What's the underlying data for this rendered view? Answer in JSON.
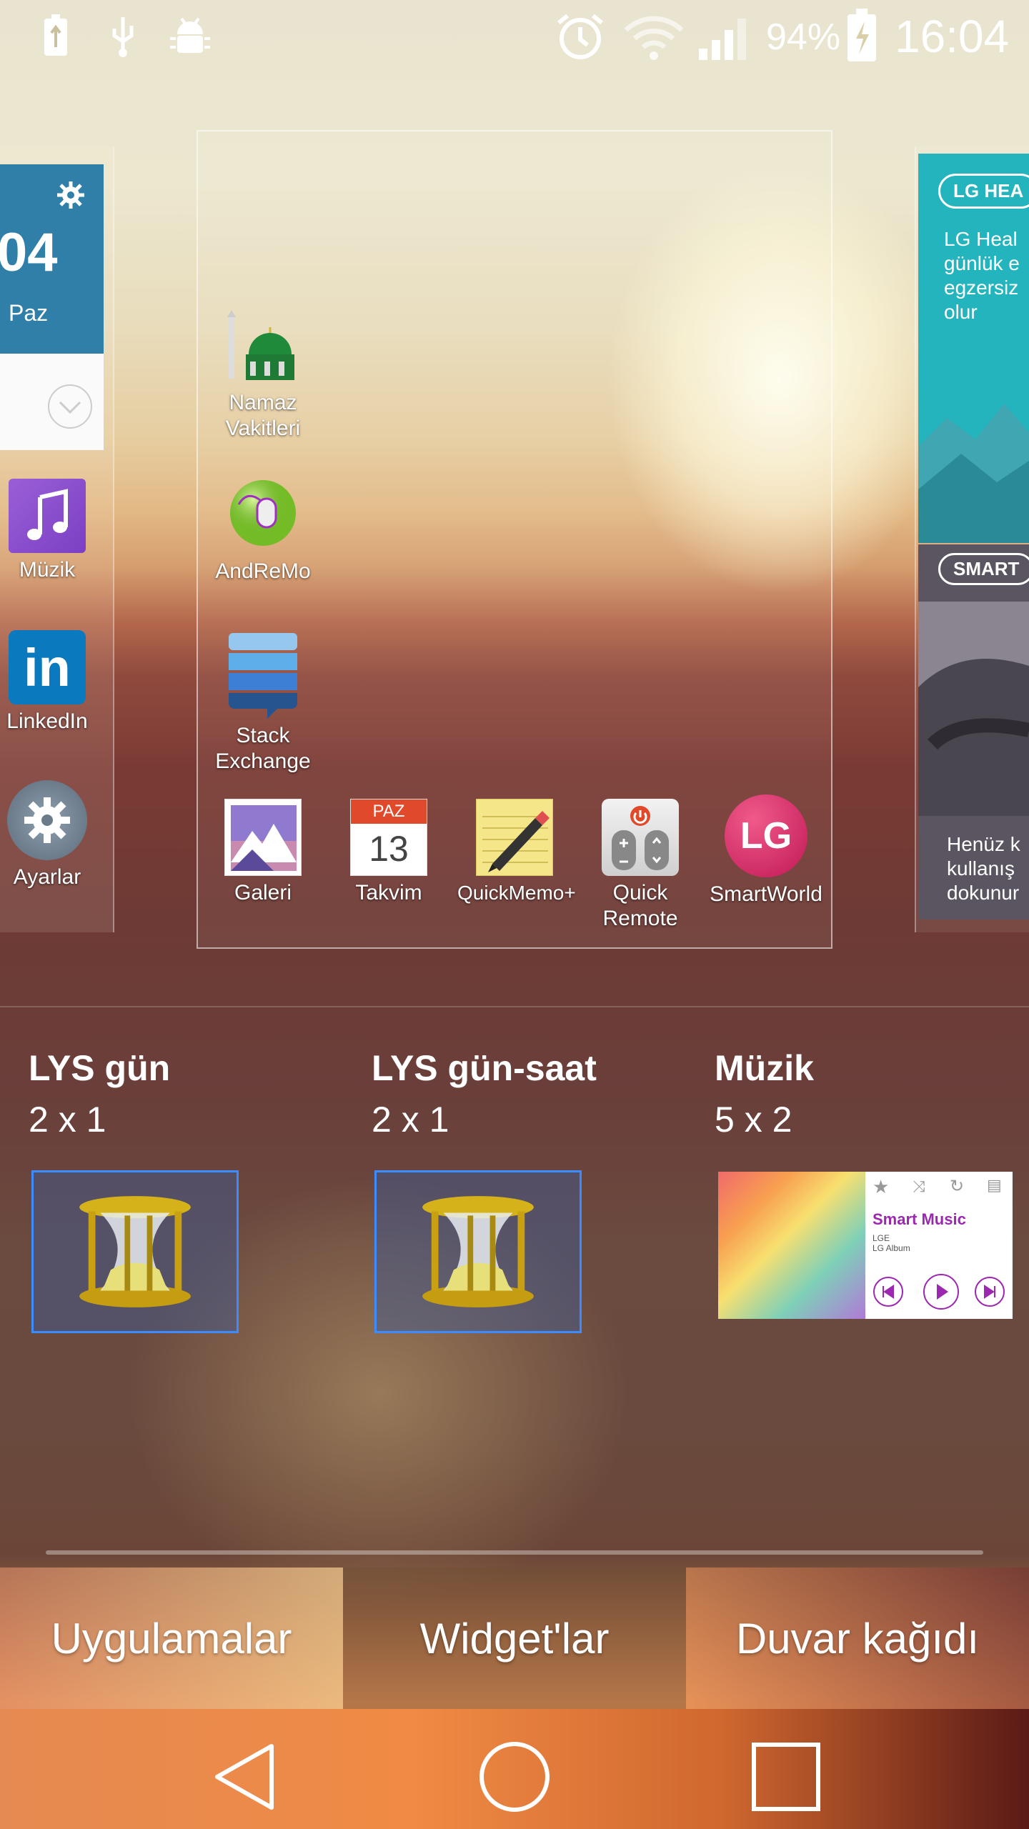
{
  "status_bar": {
    "battery_percent": "94%",
    "time": "16:04"
  },
  "left_page": {
    "widget_date": "04",
    "widget_day": "Paz",
    "apps": [
      "Müzik",
      "LinkedIn",
      "Ayarlar"
    ]
  },
  "center_page": {
    "column_apps": [
      {
        "label_line1": "Namaz",
        "label_line2": "Vakitleri"
      },
      {
        "label_line1": "AndReMo",
        "label_line2": ""
      },
      {
        "label_line1": "Stack",
        "label_line2": "Exchange"
      }
    ],
    "dock_apps": [
      {
        "label_line1": "Galeri",
        "label_line2": ""
      },
      {
        "label_line1": "Takvim",
        "label_line2": ""
      },
      {
        "label_line1": "QuickMemo+",
        "label_line2": ""
      },
      {
        "label_line1": "Quick",
        "label_line2": "Remote"
      },
      {
        "label_line1": "SmartWorld",
        "label_line2": ""
      }
    ],
    "calendar_month": "PAZ",
    "calendar_day": "13",
    "smartworld_logo": "LG"
  },
  "right_page": {
    "health_tag": "LG HEA",
    "health_text": [
      "LG Heal",
      "günlük e",
      "egzersiz",
      "olur"
    ],
    "smart_tag": "SMART",
    "bottom_text": [
      "Henüz k",
      "kullanış",
      "dokunur"
    ]
  },
  "widgets": [
    {
      "title": "LYS gün",
      "size": "2 x 1"
    },
    {
      "title": "LYS gün-saat",
      "size": "2 x 1"
    },
    {
      "title": "Müzik",
      "size": "5 x 2"
    }
  ],
  "music_preview": {
    "title": "Smart Music",
    "artist": "LGE",
    "album": "LG Album"
  },
  "tabs": {
    "apps": "Uygulamalar",
    "widgets": "Widget'lar",
    "wallpaper": "Duvar kağıdı"
  },
  "colors": {
    "accent_blue": "#3c8cff",
    "linkedin": "#0a79bd",
    "music_purple": "#9c27b0"
  }
}
